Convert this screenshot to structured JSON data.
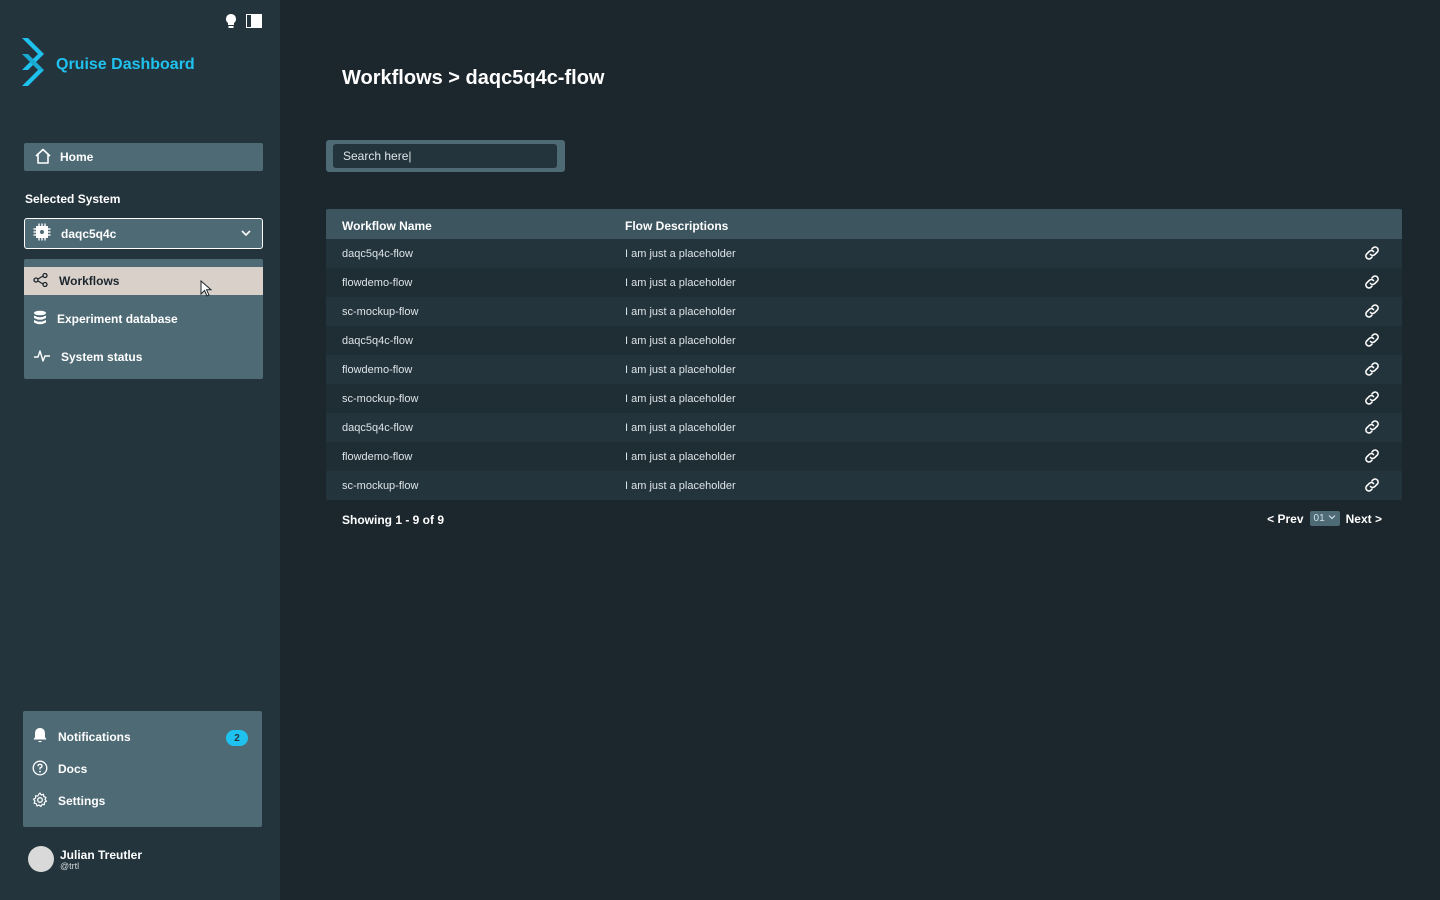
{
  "app": {
    "title": "Qruise Dashboard",
    "brand_color": "#1fc2ee"
  },
  "sidebar": {
    "home_label": "Home",
    "selected_system_label": "Selected System",
    "selected_system_value": "daqc5q4c",
    "nav": [
      {
        "label": "Workflows",
        "icon": "workflow-icon",
        "active": true
      },
      {
        "label": "Experiment database",
        "icon": "database-icon",
        "active": false
      },
      {
        "label": "System status",
        "icon": "activity-icon",
        "active": false
      }
    ],
    "bottom": [
      {
        "label": "Notifications",
        "icon": "bell-icon",
        "badge": "2"
      },
      {
        "label": "Docs",
        "icon": "help-circle-icon"
      },
      {
        "label": "Settings",
        "icon": "gear-icon"
      }
    ],
    "user": {
      "name": "Julian Treutler",
      "handle": "@trtl"
    }
  },
  "main": {
    "title": "Workflows > daqc5q4c-flow",
    "search": {
      "value": "",
      "placeholder": "Search here|"
    },
    "table": {
      "columns": [
        "Workflow Name",
        "Flow Descriptions"
      ],
      "rows": [
        {
          "name": "daqc5q4c-flow",
          "desc": "I am just a placeholder"
        },
        {
          "name": "flowdemo-flow",
          "desc": "I am just a placeholder"
        },
        {
          "name": "sc-mockup-flow",
          "desc": "I am just a placeholder"
        },
        {
          "name": "daqc5q4c-flow",
          "desc": "I am just a placeholder"
        },
        {
          "name": "flowdemo-flow",
          "desc": "I am just a placeholder"
        },
        {
          "name": "sc-mockup-flow",
          "desc": "I am just a placeholder"
        },
        {
          "name": "daqc5q4c-flow",
          "desc": "I am just a placeholder"
        },
        {
          "name": "flowdemo-flow",
          "desc": "I am just a placeholder"
        },
        {
          "name": "sc-mockup-flow",
          "desc": "I am just a placeholder"
        }
      ]
    },
    "pagination": {
      "showing": "Showing 1 - 9 of 9",
      "prev": "< Prev",
      "page": "01",
      "next": "Next >"
    }
  }
}
